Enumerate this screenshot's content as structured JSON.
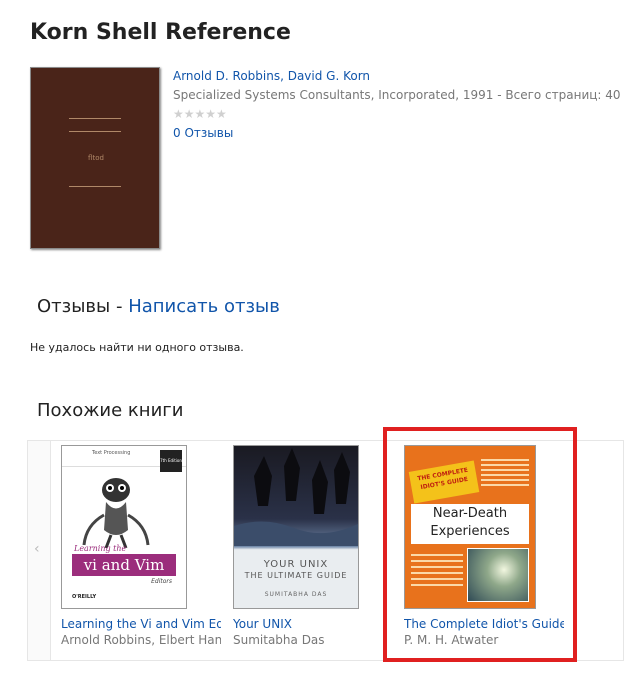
{
  "book": {
    "title": "Korn Shell Reference",
    "authors": "Arnold D. Robbins, David G. Korn",
    "publisher_line": "Specialized Systems Consultants, Incorporated, 1991 - Всего страниц: 40",
    "stars": "★★★★★",
    "reviews_link": "0 Отзывы",
    "cover_mark": "fltod"
  },
  "reviews": {
    "heading": "Отзывы - ",
    "write_link": "Написать отзыв",
    "empty_text": "Не удалось найти ни одного отзыва."
  },
  "similar": {
    "heading": "Похожие книги",
    "prev_arrow": "‹",
    "books": [
      {
        "title": "Learning the Vi and Vim Ed",
        "author": "Arnold Robbins, Elbert Han",
        "cover_top": "Text Processing",
        "cover_badge": "7th Edition",
        "cover_title_main": "vi and Vim",
        "cover_title_pre": "Learning the",
        "cover_sub": "Editors",
        "cover_publisher": "O'REILLY"
      },
      {
        "title": "Your UNIX",
        "author": "Sumitabha Das",
        "cover_title_1": "YOUR UNIX",
        "cover_title_2": "THE ULTIMATE GUIDE",
        "cover_author": "SUMITABHA DAS"
      },
      {
        "title": "The Complete Idiot's Guide",
        "author": "P. M. H. Atwater",
        "cover_brand": "THE COMPLETE IDIOT'S GUIDE",
        "cover_title_1": "Near-Death",
        "cover_title_2": "Experiences"
      }
    ]
  },
  "colors": {
    "link": "#1155aa",
    "highlight": "#e02020"
  }
}
